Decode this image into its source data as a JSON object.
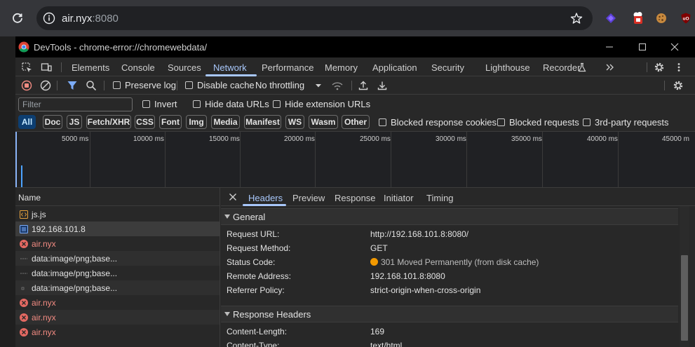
{
  "browser": {
    "url_host": "air.nyx",
    "url_port": ":8080",
    "icons": [
      "reload-icon",
      "site-info-icon",
      "bookmark-star-icon",
      "extension-purple-icon",
      "extension-popcorn-icon",
      "extension-cookie-icon",
      "extension-ublock-icon"
    ]
  },
  "devtools": {
    "title": "DevTools - chrome-error://chromewebdata/",
    "panel_tabs": [
      "Elements",
      "Console",
      "Sources",
      "Network",
      "Performance",
      "Memory",
      "Application",
      "Security",
      "Lighthouse",
      "Recorder"
    ],
    "active_panel": "Network",
    "toolbar": {
      "preserve_log": "Preserve log",
      "disable_cache": "Disable cache",
      "throttling": "No throttling"
    },
    "filter": {
      "placeholder": "Filter",
      "invert": "Invert",
      "hide_data_urls": "Hide data URLs",
      "hide_extension_urls": "Hide extension URLs"
    },
    "type_filters": [
      "All",
      "Doc",
      "JS",
      "Fetch/XHR",
      "CSS",
      "Font",
      "Img",
      "Media",
      "Manifest",
      "WS",
      "Wasm",
      "Other"
    ],
    "active_type": "All",
    "extra_filters": {
      "blocked_response_cookies": "Blocked response cookies",
      "blocked_requests": "Blocked requests",
      "third_party": "3rd-party requests"
    },
    "overview_ticks": [
      "5000 ms",
      "10000 ms",
      "15000 ms",
      "20000 ms",
      "25000 ms",
      "30000 ms",
      "35000 ms",
      "40000 ms",
      "45000 m"
    ],
    "requests": {
      "header": "Name",
      "rows": [
        {
          "name": "js.js",
          "kind": "script"
        },
        {
          "name": "192.168.101.8",
          "kind": "document"
        },
        {
          "name": "air.nyx",
          "kind": "error"
        },
        {
          "name": "data:image/png;base...",
          "kind": "image"
        },
        {
          "name": "data:image/png;base...",
          "kind": "image"
        },
        {
          "name": "data:image/png;base...",
          "kind": "image"
        },
        {
          "name": "air.nyx",
          "kind": "error"
        },
        {
          "name": "air.nyx",
          "kind": "error"
        },
        {
          "name": "air.nyx",
          "kind": "error"
        }
      ]
    },
    "details": {
      "tabs": [
        "Headers",
        "Preview",
        "Response",
        "Initiator",
        "Timing"
      ],
      "active_tab": "Headers",
      "general_title": "General",
      "general": [
        {
          "key": "Request URL:",
          "value": "http://192.168.101.8:8080/"
        },
        {
          "key": "Request Method:",
          "value": "GET"
        },
        {
          "key": "Status Code:",
          "value": "301 Moved Permanently (from disk cache)"
        },
        {
          "key": "Remote Address:",
          "value": "192.168.101.8:8080"
        },
        {
          "key": "Referrer Policy:",
          "value": "strict-origin-when-cross-origin"
        }
      ],
      "response_headers_title": "Response Headers",
      "response_headers": [
        {
          "key": "Content-Length:",
          "value": "169"
        },
        {
          "key": "Content-Type:",
          "value": "text/html"
        }
      ]
    }
  },
  "colors": {
    "accent": "#a8c7fa",
    "error": "#f28b82",
    "status_warning": "#f29900",
    "active_chip": "#0d3e71"
  }
}
